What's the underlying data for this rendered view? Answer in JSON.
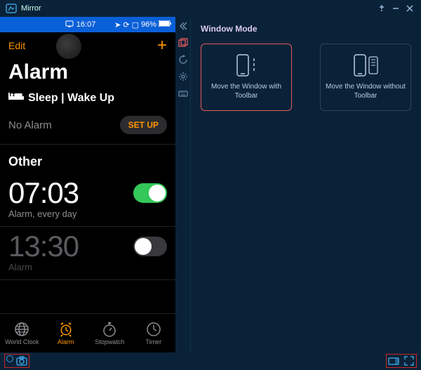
{
  "window": {
    "title": "Mirror"
  },
  "phone": {
    "status": {
      "time": "16:07",
      "battery": "96%"
    },
    "nav": {
      "edit": "Edit",
      "plus": "+"
    },
    "page_title": "Alarm",
    "sleep": {
      "label": "Sleep | Wake Up",
      "no_alarm": "No Alarm",
      "setup": "SET UP"
    },
    "other_label": "Other",
    "alarms": [
      {
        "time": "07:03",
        "label": "Alarm, every day",
        "on": true
      },
      {
        "time": "13:30",
        "label": "Alarm",
        "on": false
      }
    ],
    "tabs": [
      {
        "label": "World Clock"
      },
      {
        "label": "Alarm"
      },
      {
        "label": "Stopwatch"
      },
      {
        "label": "Timer"
      }
    ]
  },
  "settings": {
    "heading": "Window Mode",
    "cards": [
      {
        "label": "Move the Window with Toolbar"
      },
      {
        "label": "Move the Window without Toolbar"
      }
    ]
  }
}
